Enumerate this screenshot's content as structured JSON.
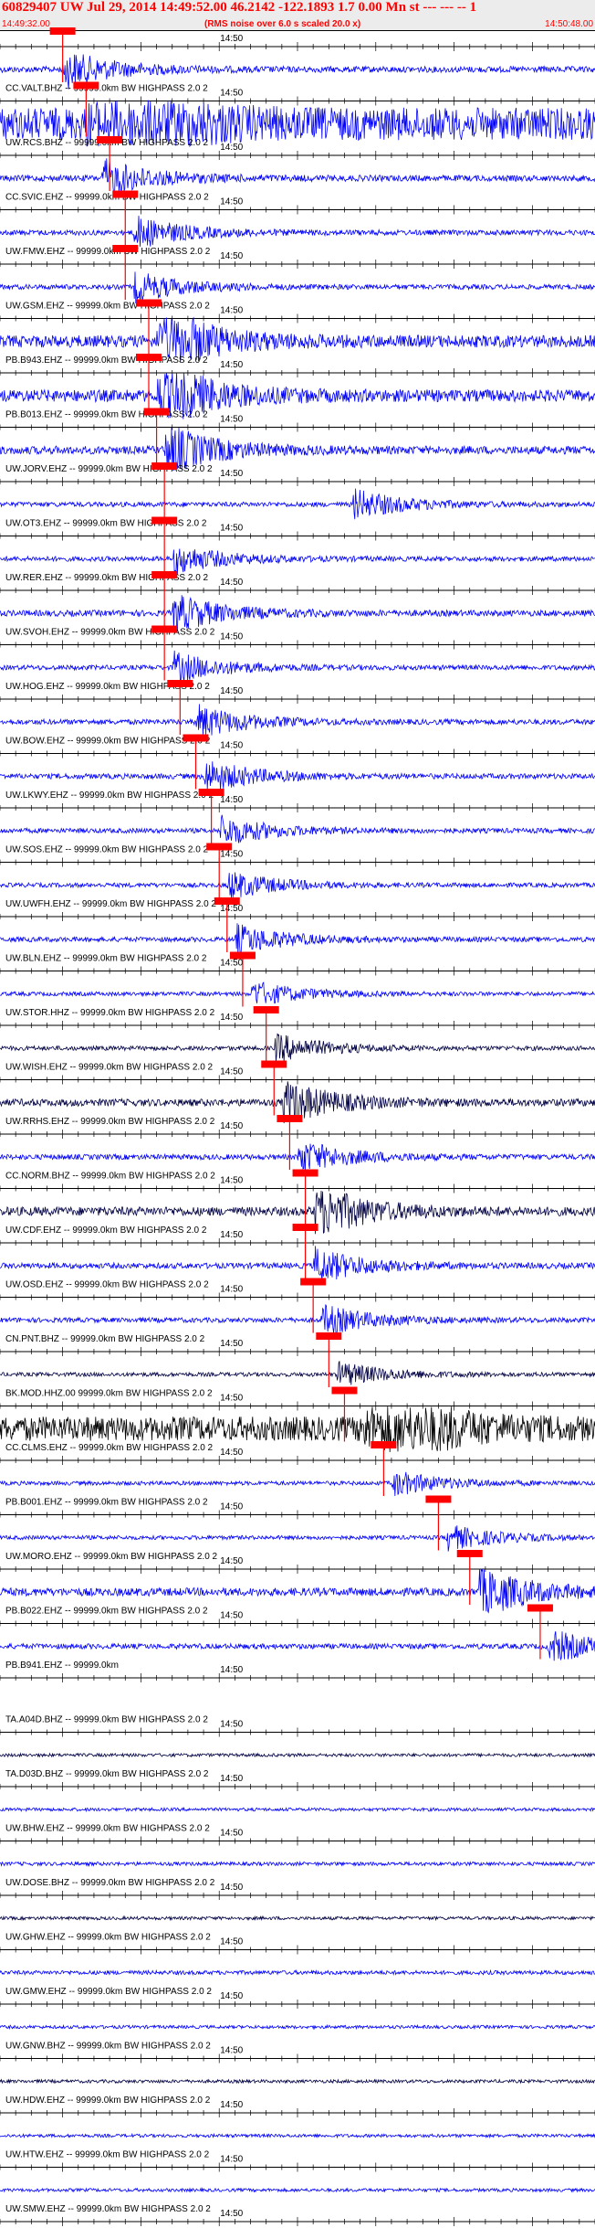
{
  "header": {
    "title": "60829407 UW Jul 29, 2014 14:49:52.00    46.2142 -122.1893  1.7 0.00 Mn st --- --- -- 1",
    "noise": "(RMS noise over 6.0 s scaled 20.0 x)",
    "time_start": "14:49:32.00",
    "time_end": "14:50:48.00"
  },
  "colors": {
    "trace": "#0000ff",
    "trace_dark": "#000044",
    "pick": "#ff0000",
    "axis": "#000000"
  },
  "chart_data": {
    "type": "line",
    "title": "60829407 UW Jul 29, 2014 14:49:52.00    46.2142 -122.1893  1.7 0.00 Mn st --- --- -- 1",
    "x_range": [
      "14:49:32.00",
      "14:50:48.00"
    ],
    "x_tick_label": "14:50",
    "traces": [
      {
        "label": "",
        "pick": "14:49:40",
        "amp": 1.5,
        "event": "14:49:40",
        "color": "blue"
      },
      {
        "label": "CC.VALT.BHZ -- 99999.0km BW  HIGHPASS  2.0  2",
        "pick": "14:49:43",
        "amp": 8,
        "event": "14:49:43",
        "color": "blue"
      },
      {
        "label": "UW.RCS.BHZ -- 99999.0km BW  HIGHPASS  2.0  2",
        "pick": "14:49:46",
        "amp": 1.5,
        "event": "14:49:45",
        "color": "blue"
      },
      {
        "label": "CC.SVIC.EHZ -- 99999.0km BW  HIGHPASS  2.0  2",
        "pick": "14:49:48",
        "amp": 1.3,
        "event": "14:49:49",
        "color": "blue"
      },
      {
        "label": "UW.FMW.EHZ -- 99999.0km BW  HIGHPASS  2.0  2",
        "pick": "14:49:48",
        "amp": 1.2,
        "event": "14:49:49",
        "color": "blue"
      },
      {
        "label": "UW.GSM.EHZ -- 99999.0km BW  HIGHPASS  2.0  2",
        "pick": "14:49:51",
        "amp": 3,
        "event": "14:49:52",
        "color": "blue"
      },
      {
        "label": "PB.B943.EHZ -- 99999.0km BW  HIGHPASS  2.0  2",
        "pick": "14:49:51",
        "amp": 3,
        "event": "14:49:52",
        "color": "blue"
      },
      {
        "label": "PB.B013.EHZ -- 99999.0km BW  HIGHPASS  2.0  2",
        "pick": "14:49:52",
        "amp": 2,
        "event": "14:49:53",
        "color": "blue"
      },
      {
        "label": "UW.JORV.EHZ -- 99999.0km BW  HIGHPASS  2.0  2",
        "pick": "14:49:53",
        "amp": 1.2,
        "event": "14:50:17",
        "color": "blue"
      },
      {
        "label": "UW.OT3.EHZ -- 99999.0km BW  HIGHPASS  2.0  2",
        "pick": "14:49:53",
        "amp": 1.2,
        "event": "14:49:54",
        "color": "blue"
      },
      {
        "label": "UW.RER.EHZ -- 99999.0km BW  HIGHPASS  2.0  2",
        "pick": "14:49:53",
        "amp": 1.5,
        "event": "14:49:54",
        "color": "blue"
      },
      {
        "label": "UW.SVOH.EHZ -- 99999.0km BW  HIGHPASS  2.0  2",
        "pick": "14:49:53",
        "amp": 1.2,
        "event": "14:49:54",
        "color": "blue"
      },
      {
        "label": "UW.HOG.EHZ -- 99999.0km BW  HIGHPASS  2.0  2",
        "pick": "14:49:55",
        "amp": 1.3,
        "event": "14:49:57",
        "color": "blue"
      },
      {
        "label": "UW.BOW.EHZ -- 99999.0km BW  HIGHPASS  2.0  2",
        "pick": "14:49:57",
        "amp": 1.3,
        "event": "14:49:58",
        "color": "blue"
      },
      {
        "label": "UW.LKWY.EHZ -- 99999.0km BW  HIGHPASS  2.0  2",
        "pick": "14:49:59",
        "amp": 1.2,
        "event": "14:50:00",
        "color": "blue"
      },
      {
        "label": "UW.SOS.EHZ -- 99999.0km BW  HIGHPASS  2.0  2",
        "pick": "14:50:00",
        "amp": 1.1,
        "event": "14:50:01",
        "color": "blue"
      },
      {
        "label": "UW.UWFH.EHZ -- 99999.0km BW  HIGHPASS  2.0  2",
        "pick": "14:50:01",
        "amp": 1.2,
        "event": "14:50:02",
        "color": "blue"
      },
      {
        "label": "UW.BLN.EHZ -- 99999.0km BW  HIGHPASS  2.0  2",
        "pick": "14:50:03",
        "amp": 1.0,
        "event": "14:50:04",
        "color": "blue"
      },
      {
        "label": "UW.STOR.HHZ -- 99999.0km BW  HIGHPASS  2.0  2",
        "pick": "14:50:06",
        "amp": 1.1,
        "event": "14:50:07",
        "color": "dark"
      },
      {
        "label": "UW.WISH.EHZ -- 99999.0km BW  HIGHPASS  2.0  2",
        "pick": "14:50:07",
        "amp": 1.8,
        "event": "14:50:08",
        "color": "dark"
      },
      {
        "label": "UW.RRHS.EHZ -- 99999.0km BW  HIGHPASS  2.0  2",
        "pick": "14:50:09",
        "amp": 1.3,
        "event": "14:50:10",
        "color": "blue"
      },
      {
        "label": "CC.NORM.BHZ -- 99999.0km BW  HIGHPASS  2.0  2",
        "pick": "14:50:11",
        "amp": 2.2,
        "event": "14:50:12",
        "color": "dark"
      },
      {
        "label": "UW.CDF.EHZ -- 99999.0km BW  HIGHPASS  2.0  2",
        "pick": "14:50:11",
        "amp": 1.4,
        "event": "14:50:12",
        "color": "blue"
      },
      {
        "label": "UW.OSD.EHZ -- 99999.0km BW  HIGHPASS  2.0  2",
        "pick": "14:50:12",
        "amp": 1.2,
        "event": "14:50:13",
        "color": "blue"
      },
      {
        "label": "CN.PNT.BHZ -- 99999.0km BW  HIGHPASS  2.0  2",
        "pick": "14:50:14",
        "amp": 1.0,
        "event": "14:50:15",
        "color": "dark"
      },
      {
        "label": "BK.MOD.HHZ.00 99999.0km BW  HIGHPASS  2.0  2",
        "pick": "14:50:16",
        "amp": 6,
        "event": "14:50:18",
        "color": "black"
      },
      {
        "label": "CC.CLMS.EHZ -- 99999.0km BW  HIGHPASS  2.0  2",
        "pick": "14:50:21",
        "amp": 1.0,
        "event": "14:50:22",
        "color": "blue"
      },
      {
        "label": "PB.B001.EHZ -- 99999.0km BW  HIGHPASS  2.0  2",
        "pick": "14:50:28",
        "amp": 1.0,
        "event": "14:50:29",
        "color": "blue"
      },
      {
        "label": "UW.MORO.EHZ -- 99999.0km BW  HIGHPASS  2.0  2",
        "pick": "14:50:32",
        "amp": 2.0,
        "event": "14:50:33",
        "color": "blue"
      },
      {
        "label": "PB.B022.EHZ -- 99999.0km BW  HIGHPASS  2.0  2",
        "pick": "14:50:41",
        "amp": 1.3,
        "event": "14:50:42",
        "color": "blue"
      },
      {
        "label": "PB.B941.EHZ -- 99999.0km",
        "pick": "",
        "amp": 0,
        "event": "",
        "color": "blue"
      },
      {
        "label": "TA.A04D.BHZ -- 99999.0km BW  HIGHPASS  2.0  2",
        "pick": "",
        "amp": 0.8,
        "event": "",
        "color": "dark"
      },
      {
        "label": "TA.D03D.BHZ -- 99999.0km BW  HIGHPASS  2.0  2",
        "pick": "",
        "amp": 0.8,
        "event": "",
        "color": "blue"
      },
      {
        "label": "UW.BHW.EHZ -- 99999.0km BW  HIGHPASS  2.0  2",
        "pick": "",
        "amp": 0.9,
        "event": "",
        "color": "blue"
      },
      {
        "label": "UW.DOSE.BHZ -- 99999.0km BW  HIGHPASS  2.0  2",
        "pick": "",
        "amp": 0.8,
        "event": "",
        "color": "dark"
      },
      {
        "label": "UW.GHW.EHZ -- 99999.0km BW  HIGHPASS  2.0  2",
        "pick": "",
        "amp": 1.0,
        "event": "",
        "color": "blue"
      },
      {
        "label": "UW.GMW.EHZ -- 99999.0km BW  HIGHPASS  2.0  2",
        "pick": "",
        "amp": 0.8,
        "event": "",
        "color": "blue"
      },
      {
        "label": "UW.GNW.BHZ -- 99999.0km BW  HIGHPASS  2.0  2",
        "pick": "",
        "amp": 0.8,
        "event": "",
        "color": "dark"
      },
      {
        "label": "UW.HDW.EHZ -- 99999.0km BW  HIGHPASS  2.0  2",
        "pick": "",
        "amp": 0.8,
        "event": "",
        "color": "blue"
      },
      {
        "label": "UW.HTW.EHZ -- 99999.0km BW  HIGHPASS  2.0  2",
        "pick": "",
        "amp": 0.8,
        "event": "",
        "color": "blue"
      },
      {
        "label": "UW.SMW.EHZ -- 99999.0km BW  HIGHPASS  2.0  2",
        "pick": "",
        "amp": 0.8,
        "event": "",
        "color": "blue"
      }
    ]
  }
}
